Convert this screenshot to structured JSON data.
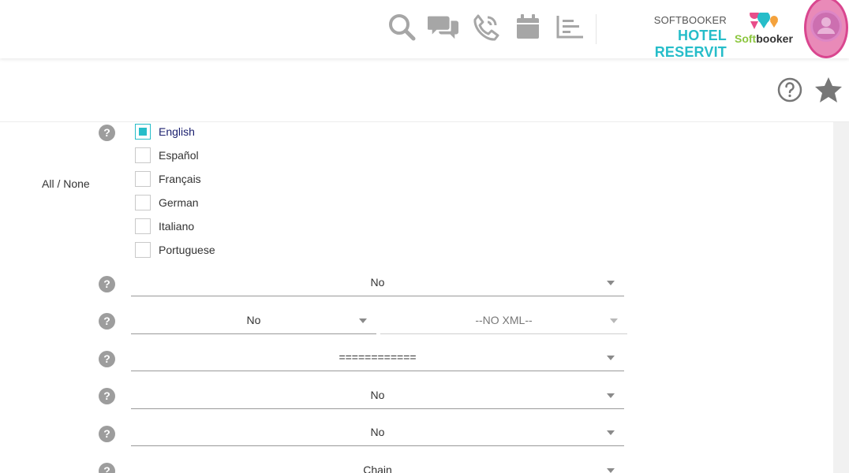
{
  "header": {
    "brand_top": "SOFTBOOKER",
    "brand_main": "HOTEL RESERVIT",
    "logo_text_a": "Soft",
    "logo_text_b": "booker",
    "icons": [
      "search-icon",
      "chat-icon",
      "phone-icon",
      "calendar-icon",
      "chart-icon"
    ]
  },
  "subbar": {
    "icons": [
      "help-circle-icon",
      "star-icon"
    ]
  },
  "languages": {
    "all_none": "All / None",
    "items": [
      {
        "label": "English",
        "checked": true
      },
      {
        "label": "Español",
        "checked": false
      },
      {
        "label": "Français",
        "checked": false
      },
      {
        "label": "German",
        "checked": false
      },
      {
        "label": "Italiano",
        "checked": false
      },
      {
        "label": "Portuguese",
        "checked": false
      }
    ]
  },
  "form": {
    "help_glyph": "?",
    "select1": "No",
    "select2a": "No",
    "select2b": "--NO XML--",
    "select3": "============",
    "select4": "No",
    "select5": "No",
    "select6": "Chain"
  },
  "colors": {
    "accent": "#26bdc9",
    "avatar": "#dd86c5",
    "avatar_ring": "#d9468f",
    "icon_grey": "#a6a6a6"
  }
}
